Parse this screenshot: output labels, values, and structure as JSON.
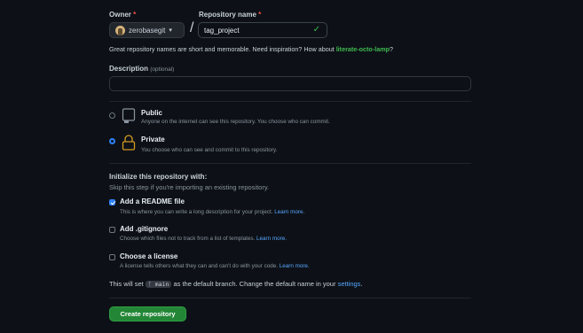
{
  "owner": {
    "label": "Owner",
    "required_mark": "*",
    "value": "zerobasegit",
    "caret": "▾"
  },
  "separator": "/",
  "repo": {
    "label": "Repository name",
    "required_mark": "*",
    "value": "tag_project",
    "valid_icon": "✓"
  },
  "name_hint": {
    "text": "Great repository names are short and memorable. Need inspiration? How about ",
    "suggestion": "literate-octo-lamp",
    "suffix": "?"
  },
  "description": {
    "label": "Description",
    "optional": "(optional)",
    "value": ""
  },
  "visibility": {
    "public": {
      "title": "Public",
      "desc": "Anyone on the internet can see this repository. You choose who can commit.",
      "selected": false,
      "icon": "repo-icon"
    },
    "private": {
      "title": "Private",
      "desc": "You choose who can see and commit to this repository.",
      "selected": true,
      "icon": "lock-icon"
    }
  },
  "init": {
    "heading": "Initialize this repository with:",
    "subheading": "Skip this step if you're importing an existing repository.",
    "readme": {
      "title": "Add a README file",
      "desc": "This is where you can write a long description for your project.",
      "link": "Learn more.",
      "checked": true
    },
    "gitignore": {
      "title": "Add .gitignore",
      "desc": "Choose which files not to track from a list of templates.",
      "link": "Learn more.",
      "checked": false
    },
    "license": {
      "title": "Choose a license",
      "desc": "A license tells others what they can and can't do with your code.",
      "link": "Learn more.",
      "checked": false
    }
  },
  "branch": {
    "prefix": "This will set",
    "name": "main",
    "middle": "as the default branch. Change the default name in your",
    "link": "settings",
    "suffix": "."
  },
  "create_button": "Create repository",
  "colors": {
    "background": "#0d1117",
    "accent": "#2f81f7",
    "success": "#238636",
    "link": "#58a6ff"
  }
}
